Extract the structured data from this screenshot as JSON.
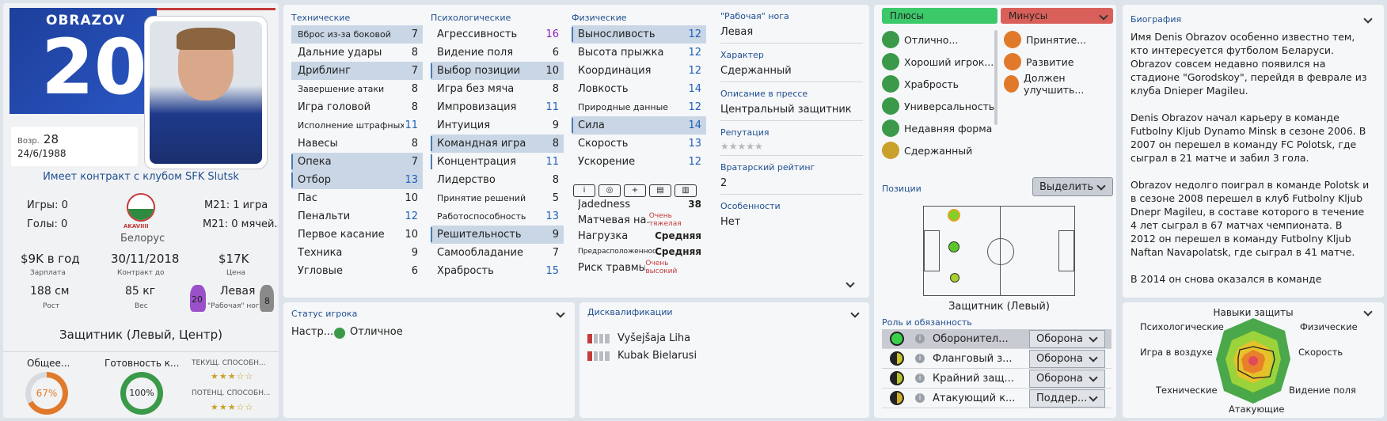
{
  "profile": {
    "surname": "OBRAZOV",
    "number": "20",
    "age_label": "Возр.",
    "age": "28",
    "dob": "24/6/1988",
    "contract_text": "Имеет контракт с клубом SFK Slutsk",
    "apps": "Игры: 0",
    "goals": "Голы: 0",
    "nationality": "Белорус",
    "u21_apps": "М21: 1 игра",
    "u21_goals": "М21: 0 мячей.",
    "wage": "$9K в год",
    "wage_label": "Зарплата",
    "contract_end": "30/11/2018",
    "contract_end_label": "Контракт до",
    "value": "$17K",
    "value_label": "Цена",
    "height": "188 см",
    "height_label": "Рост",
    "weight": "85 кг",
    "weight_label": "Вес",
    "foot": "Левая",
    "foot_label": "\"Рабочая\" нога",
    "foot_left": "20",
    "foot_right": "8",
    "position": "Защитник (Левый, Центр)",
    "overall_label": "Общее...",
    "overall": "67%",
    "fitness_label": "Готовность к...",
    "fitness": "100%",
    "cur_ability_label": "ТЕКУЩ. СПОСОБН...",
    "pot_ability_label": "ПОТЕНЦ. СПОСОБН...",
    "flag_text": "AKAVIIII"
  },
  "technical": {
    "title": "Технические",
    "items": [
      {
        "name": "Вброс из-за боковой",
        "value": "7",
        "small": true,
        "hl": true
      },
      {
        "name": "Дальние удары",
        "value": "8"
      },
      {
        "name": "Дриблинг",
        "value": "7",
        "hl": true
      },
      {
        "name": "Завершение атаки",
        "value": "8",
        "small": true
      },
      {
        "name": "Игра головой",
        "value": "8"
      },
      {
        "name": "Исполнение штрафных",
        "value": "11",
        "small": true,
        "blue": true
      },
      {
        "name": "Навесы",
        "value": "8"
      },
      {
        "name": "Опека",
        "value": "7",
        "hl": true,
        "mark": true
      },
      {
        "name": "Отбор",
        "value": "13",
        "hl": true,
        "mark": true,
        "blue": true
      },
      {
        "name": "Пас",
        "value": "10"
      },
      {
        "name": "Пенальти",
        "value": "12",
        "blue": true
      },
      {
        "name": "Первое касание",
        "value": "10"
      },
      {
        "name": "Техника",
        "value": "9"
      },
      {
        "name": "Угловые",
        "value": "6"
      }
    ]
  },
  "mental": {
    "title": "Психологические",
    "items": [
      {
        "name": "Агрессивность",
        "value": "16",
        "purple": true
      },
      {
        "name": "Видение поля",
        "value": "6"
      },
      {
        "name": "Выбор позиции",
        "value": "10",
        "hl": true,
        "mark": true
      },
      {
        "name": "Игра без мяча",
        "value": "8"
      },
      {
        "name": "Импровизация",
        "value": "11",
        "blue": true
      },
      {
        "name": "Интуиция",
        "value": "9"
      },
      {
        "name": "Командная игра",
        "value": "8",
        "hl": true,
        "mark": true
      },
      {
        "name": "Концентрация",
        "value": "11",
        "blue": true,
        "mark": true
      },
      {
        "name": "Лидерство",
        "value": "8"
      },
      {
        "name": "Принятие решений",
        "value": "5",
        "small": true
      },
      {
        "name": "Работоспособность",
        "value": "13",
        "small": true,
        "blue": true
      },
      {
        "name": "Решительность",
        "value": "9",
        "hl": true,
        "mark": true
      },
      {
        "name": "Самообладание",
        "value": "7"
      },
      {
        "name": "Храбрость",
        "value": "15",
        "blue": true
      }
    ]
  },
  "physical": {
    "title": "Физические",
    "items": [
      {
        "name": "Выносливость",
        "value": "12",
        "hl": true,
        "mark": true,
        "blue": true
      },
      {
        "name": "Высота прыжка",
        "value": "12",
        "blue": true
      },
      {
        "name": "Координация",
        "value": "12",
        "blue": true
      },
      {
        "name": "Ловкость",
        "value": "14",
        "blue": true
      },
      {
        "name": "Природные данные",
        "value": "12",
        "small": true,
        "blue": true
      },
      {
        "name": "Сила",
        "value": "14",
        "hl": true,
        "mark": true,
        "blue": true
      },
      {
        "name": "Скорость",
        "value": "13",
        "blue": true
      },
      {
        "name": "Ускорение",
        "value": "12",
        "blue": true
      }
    ]
  },
  "condition": [
    {
      "name": "Jadedness",
      "value": "38"
    },
    {
      "name": "Матчевая на...",
      "value": "Очень тяжелая",
      "red": true
    },
    {
      "name": "Нагрузка",
      "value": "Средняя"
    },
    {
      "name": "Предрасположенность к т...",
      "value": "Средняя",
      "small": true
    },
    {
      "name": "Риск травмы",
      "value": "Очень высокий",
      "red": true
    }
  ],
  "info": {
    "foot_label": "\"Рабочая\" нога",
    "foot": "Левая",
    "character_label": "Характер",
    "character": "Сдержанный",
    "press_label": "Описание в прессе",
    "press": "Центральный защитник",
    "rep_label": "Репутация",
    "gk_label": "Вратарский рейтинг",
    "gk": "2",
    "features_label": "Особенности",
    "features": "Нет"
  },
  "pros": {
    "title": "Плюсы",
    "items": [
      "Отлично...",
      "Хороший игрок...",
      "Храбрость",
      "Универсальность",
      "Недавняя форма",
      "Сдержанный"
    ]
  },
  "cons": {
    "title": "Минусы",
    "items": [
      "Принятие...",
      "Развитие",
      "Должен улучшить..."
    ]
  },
  "positions": {
    "title": "Позиции",
    "select": "Выделить",
    "current": "Защитник (Левый)"
  },
  "roles": {
    "title": "Роль и обязанность",
    "items": [
      {
        "name": "Оборонител...",
        "duty": "Оборона"
      },
      {
        "name": "Фланговый з...",
        "duty": "Оборона"
      },
      {
        "name": "Крайний защ...",
        "duty": "Оборона"
      },
      {
        "name": "Атакующий к...",
        "duty": "Поддер..."
      }
    ]
  },
  "status": {
    "title": "Статус игрока",
    "label": "Настр...",
    "value": "Отличное"
  },
  "bans": {
    "title": "Дисквалификации",
    "items": [
      "Vyšejšaja Liha",
      "Kubak Bielarusi"
    ]
  },
  "bio": {
    "title": "Биография",
    "text": "Имя Denis Obrazov особенно известно тем, кто интересуется футболом Беларуси. Obrazov совсем недавно появился на стадионе \"Gorodskoy\", перейдя в феврале из клуба Dnieper Magileu.\n\nDenis Obrazov начал карьеру в команде Futbolny Kljub Dynamo Minsk в сезоне 2006. В 2007 он перешел в команду FC Polotsk, где сыграл в 21 матче и забил 3 гола.\n\nObrazov недолго поиграл в команде Polotsk и в сезоне 2008 перешел в клуб Futbolny Kljub Dnepr Magileu, в составе которого в течение 4 лет сыграл в 67 матчах чемпионата. В 2012 он перешел в команду Futbolny Kljub Naftan Navapolatsk, где сыграл в 41 матче.\n\nВ 2014 он снова оказался в команде"
  },
  "radar": {
    "title": "Навыки защиты",
    "labels": [
      "Психологические",
      "Физические",
      "Игра в воздухе",
      "Скорость",
      "Технические",
      "Видение поля",
      "Атакующие"
    ]
  }
}
